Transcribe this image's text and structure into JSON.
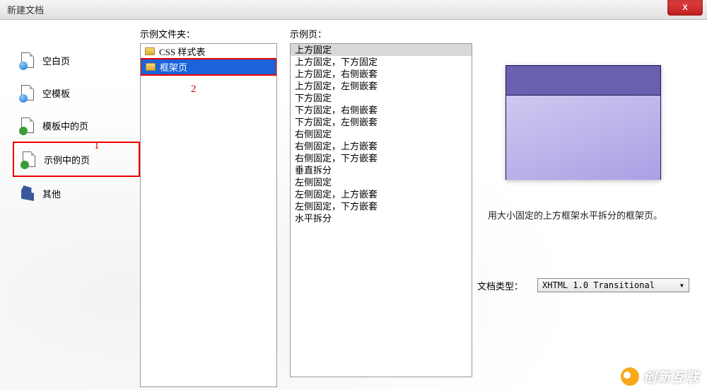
{
  "window": {
    "title": "新建文档",
    "close_icon": "X"
  },
  "sidebar": {
    "items": [
      {
        "label": "空白页",
        "icon": "blue"
      },
      {
        "label": "空模板",
        "icon": "blue"
      },
      {
        "label": "模板中的页",
        "icon": "green"
      },
      {
        "label": "示例中的页",
        "icon": "green"
      },
      {
        "label": "其他",
        "icon": "other"
      }
    ],
    "selected_index": 3
  },
  "annotations": {
    "one": "1",
    "two": "2"
  },
  "folder_col": {
    "header": "示例文件夹：",
    "items": [
      "CSS 样式表",
      "框架页"
    ],
    "selected_index": 1
  },
  "page_col": {
    "header": "示例页：",
    "items": [
      "上方固定",
      "上方固定，下方固定",
      "上方固定，右侧嵌套",
      "上方固定，左侧嵌套",
      "下方固定",
      "下方固定，右侧嵌套",
      "下方固定，左侧嵌套",
      "右侧固定",
      "右侧固定，上方嵌套",
      "右侧固定，下方嵌套",
      "垂直拆分",
      "左侧固定",
      "左侧固定，上方嵌套",
      "左侧固定，下方嵌套",
      "水平拆分"
    ],
    "selected_index": 0
  },
  "preview": {
    "description": "用大小固定的上方框架水平拆分的框架页。"
  },
  "doctype": {
    "label": "文档类型：",
    "value": "XHTML 1.0 Transitional",
    "arrow": "▾"
  },
  "watermark": {
    "text": "创新互联"
  }
}
